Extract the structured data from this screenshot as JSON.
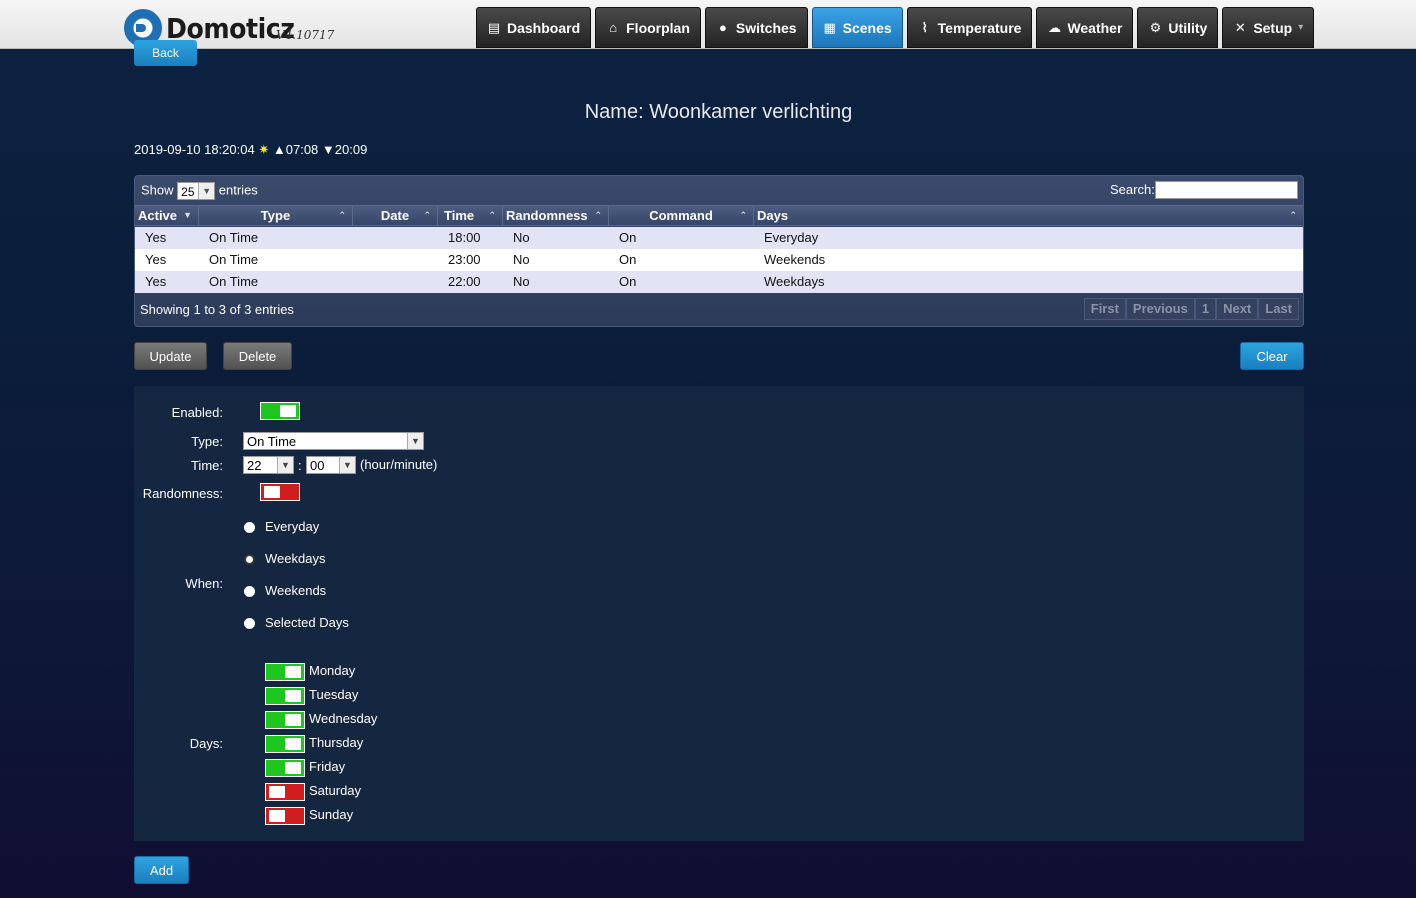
{
  "header": {
    "back_label": "Back",
    "logo_text": "Domoticz",
    "version": "V4.10717",
    "nav": [
      {
        "label": "Dashboard",
        "icon": "dashboard-icon",
        "glyph": "▤"
      },
      {
        "label": "Floorplan",
        "icon": "house-icon",
        "glyph": "⌂"
      },
      {
        "label": "Switches",
        "icon": "lightbulb-icon",
        "glyph": "●"
      },
      {
        "label": "Scenes",
        "icon": "clapperboard-icon",
        "glyph": "▦"
      },
      {
        "label": "Temperature",
        "icon": "thermometer-icon",
        "glyph": "⌇"
      },
      {
        "label": "Weather",
        "icon": "cloud-icon",
        "glyph": "☁"
      },
      {
        "label": "Utility",
        "icon": "utility-icon",
        "glyph": "⚙"
      },
      {
        "label": "Setup",
        "icon": "tools-icon",
        "glyph": "✕"
      }
    ],
    "setup_caret": "▾",
    "active_tab": "Scenes"
  },
  "page": {
    "title": "Name: Woonkamer verlichting",
    "datetime": "2019-09-10 18:20:04",
    "sun_glyph": "✷",
    "sunrise": "▲07:08",
    "sunset": "▼20:09"
  },
  "table": {
    "show_label": "Show",
    "page_size": "25",
    "entries_label": "entries",
    "search_label": "Search:",
    "search_value": "",
    "columns": [
      "Active",
      "Type",
      "Date",
      "Time",
      "Randomness",
      "Command",
      "Days"
    ],
    "rows": [
      {
        "active": "Yes",
        "type": "On Time",
        "date": "",
        "time": "18:00",
        "randomness": "No",
        "command": "On",
        "days": "Everyday"
      },
      {
        "active": "Yes",
        "type": "On Time",
        "date": "",
        "time": "23:00",
        "randomness": "No",
        "command": "On",
        "days": "Weekends"
      },
      {
        "active": "Yes",
        "type": "On Time",
        "date": "",
        "time": "22:00",
        "randomness": "No",
        "command": "On",
        "days": "Weekdays"
      }
    ],
    "showing": "Showing 1 to 3 of 3 entries",
    "pager": [
      "First",
      "Previous",
      "1",
      "Next",
      "Last"
    ]
  },
  "actions": {
    "update": "Update",
    "delete": "Delete",
    "clear": "Clear",
    "add": "Add"
  },
  "form": {
    "enabled_label": "Enabled:",
    "enabled": true,
    "type_label": "Type:",
    "type_value": "On Time",
    "time_label": "Time:",
    "hour": "22",
    "minute": "00",
    "time_sep": ":",
    "time_unit": "(hour/minute)",
    "randomness_label": "Randomness:",
    "randomness": false,
    "when_label": "When:",
    "when_options": [
      "Everyday",
      "Weekdays",
      "Weekends",
      "Selected Days"
    ],
    "when_selected": "Weekdays",
    "days_label": "Days:",
    "days": [
      {
        "name": "Monday",
        "on": true
      },
      {
        "name": "Tuesday",
        "on": true
      },
      {
        "name": "Wednesday",
        "on": true
      },
      {
        "name": "Thursday",
        "on": true
      },
      {
        "name": "Friday",
        "on": true
      },
      {
        "name": "Saturday",
        "on": false
      },
      {
        "name": "Sunday",
        "on": false
      }
    ]
  },
  "colors": {
    "toggle_on": "#1ec71e",
    "toggle_off": "#d01e1e",
    "accent_blue": "#1a7fbf"
  }
}
